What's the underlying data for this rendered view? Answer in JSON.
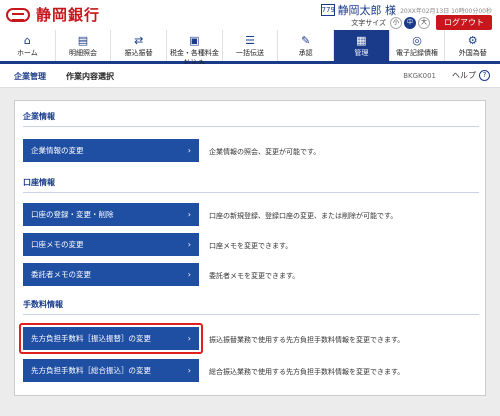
{
  "header": {
    "bank_name": "静岡銀行",
    "user_badge": "779",
    "user_name": "静岡太郎 様",
    "last_login": "20XX年02月13日 10時00分00秒",
    "text_size_label": "文字サイズ",
    "text_size_options": [
      "小",
      "中",
      "大"
    ],
    "logout_label": "ログアウト"
  },
  "nav": {
    "items": [
      {
        "label": "ホーム",
        "icon": "home-icon"
      },
      {
        "label": "明細照会",
        "icon": "statement-icon"
      },
      {
        "label": "振込振替",
        "icon": "transfer-icon"
      },
      {
        "label": "税金・各種料金払込み",
        "icon": "tax-icon"
      },
      {
        "label": "一括伝送",
        "icon": "bulk-icon"
      },
      {
        "label": "承認",
        "icon": "approval-icon"
      },
      {
        "label": "管理",
        "icon": "admin-icon"
      },
      {
        "label": "電子記録債権",
        "icon": "erecord-icon"
      },
      {
        "label": "外国為替",
        "icon": "forex-icon"
      }
    ],
    "active_index": 6
  },
  "titlebar": {
    "crumb": "企業管理",
    "title": "作業内容選択",
    "screen_id": "BKGK001",
    "help": "ヘルプ"
  },
  "sections": [
    {
      "heading": "企業情報",
      "items": [
        {
          "label": "企業情報の変更",
          "desc": "企業情報の照会、変更が可能です。"
        }
      ]
    },
    {
      "heading": "口座情報",
      "items": [
        {
          "label": "口座の登録・変更・削除",
          "desc": "口座の新規登録、登録口座の変更、または削除が可能です。"
        },
        {
          "label": "口座メモの変更",
          "desc": "口座メモを変更できます。"
        },
        {
          "label": "委託者メモの変更",
          "desc": "委託者メモを変更できます。"
        }
      ]
    },
    {
      "heading": "手数料情報",
      "items": [
        {
          "label": "先方負担手数料［振込振替］の変更",
          "desc": "振込振替業務で使用する先方負担手数料情報を変更できます。"
        },
        {
          "label": "先方負担手数料［総合振込］の変更",
          "desc": "総合振込業務で使用する先方負担手数料情報を変更できます。"
        }
      ]
    }
  ],
  "colors": {
    "brand_red": "#c8161d",
    "nav_blue": "#1a3a8a",
    "button_blue": "#1f4fa3",
    "highlight_red": "#e02020"
  }
}
